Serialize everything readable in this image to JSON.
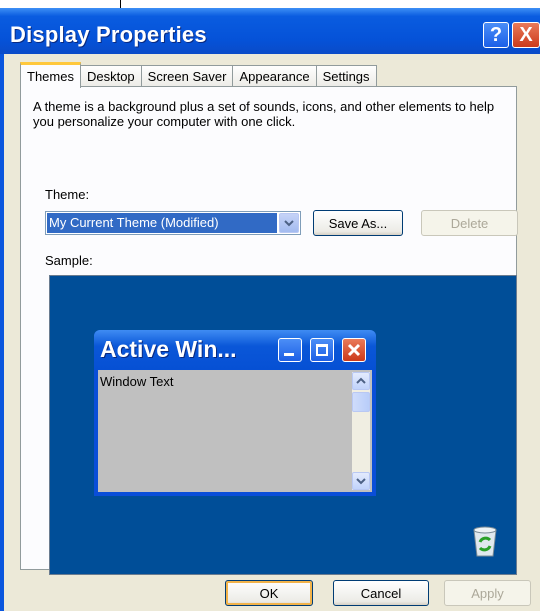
{
  "window": {
    "title": "Display Properties",
    "help_label": "?",
    "close_label": "X"
  },
  "tabs": [
    {
      "label": "Themes",
      "active": true
    },
    {
      "label": "Desktop"
    },
    {
      "label": "Screen Saver"
    },
    {
      "label": "Appearance"
    },
    {
      "label": "Settings"
    }
  ],
  "themes": {
    "description": "A theme is a background plus a set of sounds, icons, and other elements to help you personalize your computer with one click.",
    "theme_label": "Theme:",
    "theme_value": "My Current Theme (Modified)",
    "save_as_label": "Save As...",
    "delete_label": "Delete",
    "sample_label": "Sample:"
  },
  "sample": {
    "active_window_title": "Active Win...",
    "window_text": "Window Text",
    "background_color": "#004E98"
  },
  "footer": {
    "ok_label": "OK",
    "cancel_label": "Cancel",
    "apply_label": "Apply"
  },
  "icons": [
    "help-icon",
    "close-icon",
    "chevron-down-icon",
    "minimize-icon",
    "maximize-icon",
    "recycle-bin-icon"
  ]
}
